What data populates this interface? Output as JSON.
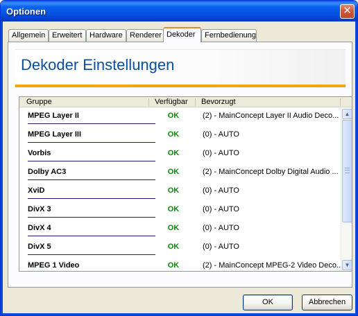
{
  "window": {
    "title": "Optionen",
    "close_glyph": "✕"
  },
  "tabs": [
    {
      "label": "Allgemein"
    },
    {
      "label": "Erweitert"
    },
    {
      "label": "Hardware"
    },
    {
      "label": "Renderer"
    },
    {
      "label": "Dekoder",
      "active": true
    },
    {
      "label": "Fernbedienung"
    }
  ],
  "panel": {
    "heading": "Dekoder Einstellungen",
    "accent_color": "#f0a70f"
  },
  "list": {
    "columns": {
      "group": "Gruppe",
      "available": "Verfügbar",
      "preferred": "Bevorzugt"
    },
    "rows": [
      {
        "group": "MPEG Layer II",
        "available": "OK",
        "preferred": "(2) - MainConcept Layer II Audio Deco..."
      },
      {
        "group": "MPEG Layer III",
        "available": "OK",
        "preferred": "(0) - AUTO"
      },
      {
        "group": "Vorbis",
        "available": "OK",
        "preferred": "(0) - AUTO"
      },
      {
        "group": "Dolby AC3",
        "available": "OK",
        "preferred": "(2) - MainConcept Dolby Digital Audio ..."
      },
      {
        "group": "XviD",
        "available": "OK",
        "preferred": "(0) - AUTO"
      },
      {
        "group": "DivX 3",
        "available": "OK",
        "preferred": "(0) - AUTO"
      },
      {
        "group": "DivX 4",
        "available": "OK",
        "preferred": "(0) - AUTO"
      },
      {
        "group": "DivX 5",
        "available": "OK",
        "preferred": "(0) - AUTO"
      },
      {
        "group": "MPEG 1 Video",
        "available": "OK",
        "preferred": "(2) - MainConcept MPEG-2 Video Deco..."
      }
    ],
    "scroll_up_glyph": "▲",
    "scroll_down_glyph": "▼"
  },
  "buttons": {
    "ok": "OK",
    "cancel": "Abbrechen"
  }
}
